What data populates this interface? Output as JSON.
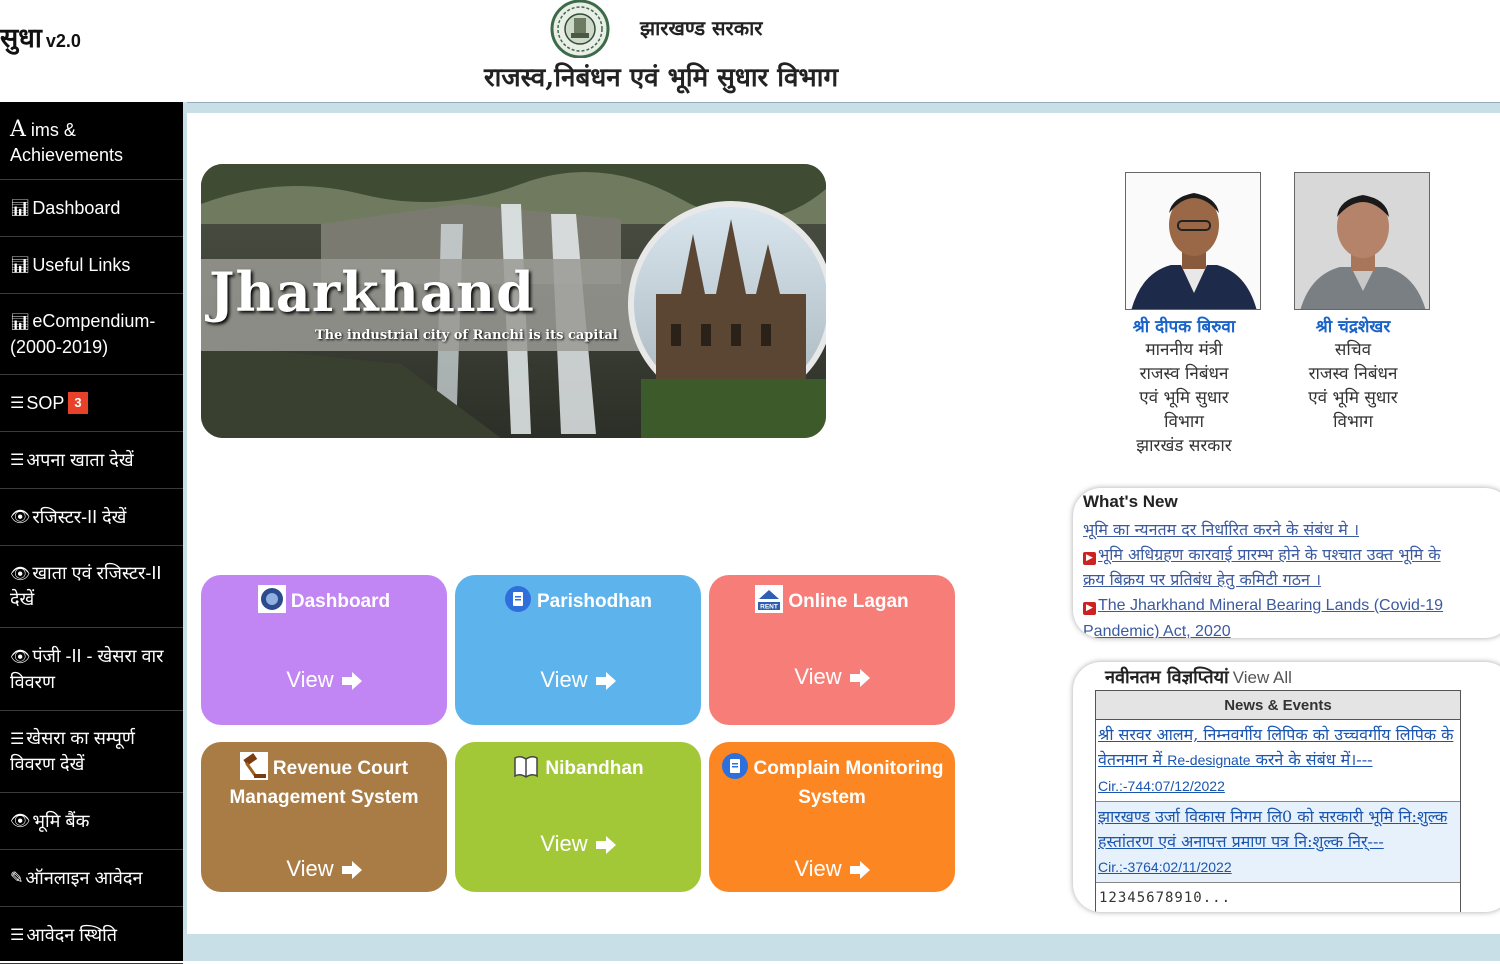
{
  "header": {
    "brand": "सुधा",
    "version": "v2.0",
    "government": "झारखण्ड सरकार",
    "department": "राजस्व,निबंधन एवं भूमि सुधार  विभाग"
  },
  "sidebar": {
    "items": [
      {
        "icon": "aims-icon",
        "first_letter": "A",
        "label": "ims & Achievements"
      },
      {
        "icon": "bar-chart-icon",
        "label": "Dashboard"
      },
      {
        "icon": "bar-chart-icon",
        "label": "Useful Links"
      },
      {
        "icon": "bar-chart-icon",
        "label": "eCompendium-(2000-2019)"
      },
      {
        "icon": "list-icon",
        "label": "SOP",
        "badge": "3"
      },
      {
        "icon": "list-icon",
        "label": "अपना खाता देखें"
      },
      {
        "icon": "eye-icon",
        "label": "रजिस्टर-II देखें"
      },
      {
        "icon": "eye-icon",
        "label": "खाता एवं रजिस्टर-II देखें"
      },
      {
        "icon": "eye-icon",
        "label": "पंजी -II - खेसरा वार विवरण"
      },
      {
        "icon": "list-icon",
        "label": "खेसरा का सम्पूर्ण विवरण देखें"
      },
      {
        "icon": "eye-icon",
        "label": "भूमि बैंक"
      },
      {
        "icon": "edit-icon",
        "label": "ऑनलाइन आवेदन"
      },
      {
        "icon": "list-icon",
        "label": "आवेदन स्थिति"
      }
    ]
  },
  "banner": {
    "title": "Jharkhand",
    "subtitle": "The industrial city of Ranchi is its capital"
  },
  "tiles": [
    {
      "title": "Dashboard",
      "view": "View",
      "color": "#c185f4"
    },
    {
      "title": "Parishodhan",
      "view": "View",
      "color": "#5db3ec"
    },
    {
      "title": "Online Lagan",
      "view": "View",
      "color": "#f77e78"
    },
    {
      "title": "Revenue Court Management System",
      "view": "View",
      "color": "#a97c45"
    },
    {
      "title": "Nibandhan",
      "view": "View",
      "color": "#a2c737"
    },
    {
      "title": "Complain Monitoring System",
      "view": "View",
      "color": "#fb8622"
    }
  ],
  "officials": [
    {
      "name": "श्री दीपक बिरुवा",
      "designation": [
        "माननीय मंत्री",
        "राजस्व निबंधन",
        "एवं भूमि सुधार",
        "विभाग",
        "झारखंड सरकार"
      ]
    },
    {
      "name": "श्री चंद्रशेखर",
      "designation": [
        "सचिव",
        "राजस्व निबंधन",
        "एवं भूमि सुधार",
        "विभाग"
      ]
    }
  ],
  "whats_new": {
    "title": "What's New",
    "items": [
      "भूमि का न्यनतम दर निर्धारित करने के संबंध मे ।",
      "भूमि अधिग्रहण कारवाई प्रारम्भ होने के पश्चात उक्त भूमि के क्रय बिक्रय पर प्रतिबंध हेतु कमिटी गठन ।",
      "The Jharkhand Mineral Bearing Lands (Covid-19 Pandemic) Act, 2020"
    ]
  },
  "notifications": {
    "title": "नवीनतम विज्ञप्तियां",
    "view_all": "View All",
    "table_header": "News & Events",
    "rows": [
      {
        "text": "श्री सरवर आलम, निम्नवर्गीय लिपिक को उच्चवर्गीय लिपिक के वेतनमान में ",
        "text_small": "Re-designate",
        "text_end": " करने के संबंध में।---",
        "circular": "Cir.:-744:07/12/2022"
      },
      {
        "text": "झारखण्ड उर्जा विकास निगम लि0 को सरकारी भूमि नि:शुल्क हस्तांतरण एवं अनापत्त प्रमाण पत्र नि:शुल्क निर्---",
        "text_small": "",
        "text_end": "",
        "circular": "Cir.:-3764:02/11/2022"
      }
    ],
    "pagination": "12345678910..."
  }
}
